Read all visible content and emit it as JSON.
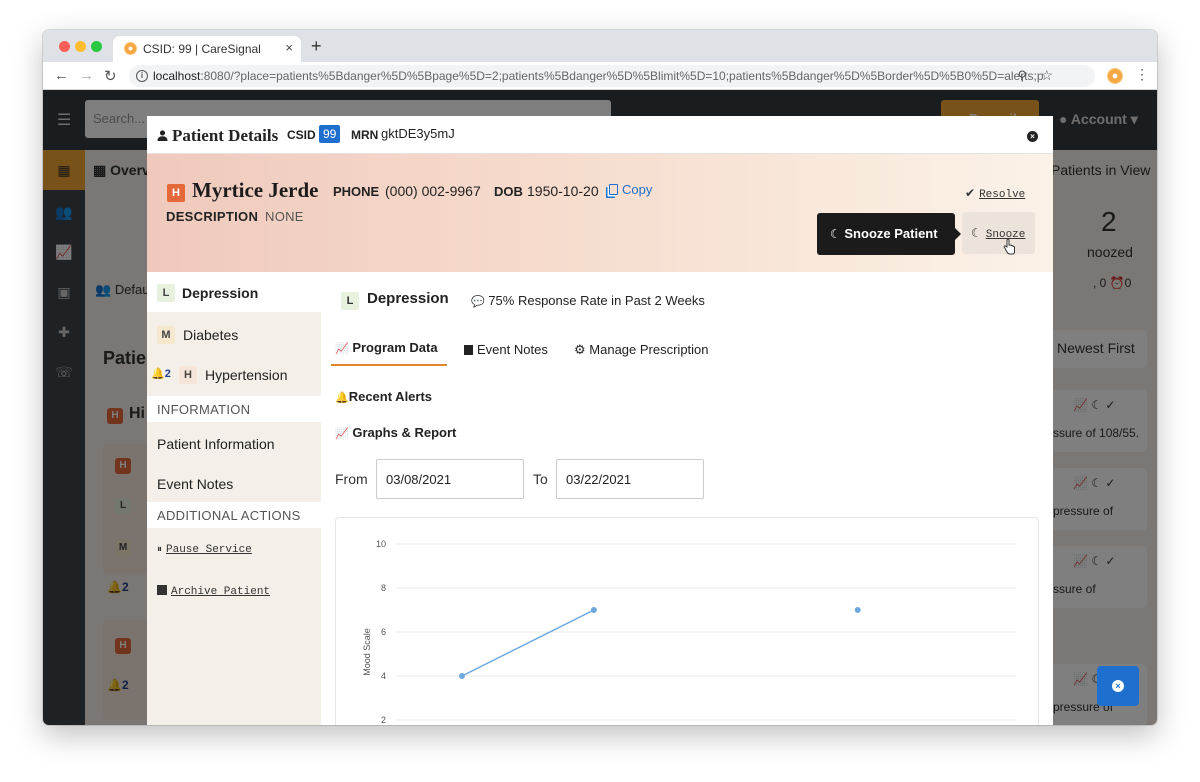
{
  "browser": {
    "tab_title": "CSID: 99 | CareSignal",
    "new_tab": "+",
    "tab_close": "×",
    "url_host": "localhost",
    "url_rest": ":8080/?place=patients%5Bdanger%5D%5Bpage%5D=2;patients%5Bdanger%5D%5Blimit%5D=10;patients%5Bdanger%5D%5Border%5D%5B0%5D=alerts;patien...",
    "back": "←",
    "forward": "→",
    "reload": "↻",
    "zoom_icon": "⚲",
    "star_icon": "☆",
    "menu_icon": "⋮"
  },
  "app_background": {
    "search_placeholder": "Search...",
    "prescription_button": "Prescribe",
    "account": "Account",
    "overview_label": "Overv",
    "patients_in_view": "Patients in View",
    "snoozed_count": "2",
    "snoozed_label": "noozed",
    "snoozed_meta": ", 0   ⏰0",
    "default_label": "Defau",
    "patients_heading": "Patie",
    "high_label": "Hi",
    "sort_label": "Newest First",
    "alert_snippets": [
      "ssure of 108/55.",
      "pressure of",
      "ssure of",
      "pressure of"
    ]
  },
  "modal": {
    "title": "Patient Details",
    "csid_label": "CSID",
    "csid_value": "99",
    "mrn_label": "MRN",
    "mrn_value": "gktDE3y5mJ",
    "close_icon": "×"
  },
  "patient": {
    "risk_chip": "H",
    "name": "Myrtice Jerde",
    "phone_label": "PHONE",
    "phone_value": "(000) 002-9967",
    "dob_label": "DOB",
    "dob_value": "1950-10-20",
    "copy_label": "Copy",
    "description_label": "DESCRIPTION",
    "description_value": "NONE",
    "resolve_label": "Resolve",
    "snooze_tooltip": "Snooze Patient",
    "snooze_label": "Snooze"
  },
  "sidebar": {
    "programs": [
      {
        "chip": "L",
        "label": "Depression",
        "active": true
      },
      {
        "chip": "M",
        "label": "Diabetes",
        "active": false
      },
      {
        "chip": "H",
        "label": "Hypertension",
        "active": false,
        "alert_count": "2"
      }
    ],
    "information_heading": "INFORMATION",
    "info_links": [
      "Patient Information",
      "Event Notes"
    ],
    "actions_heading": "ADDITIONAL ACTIONS",
    "actions": [
      "Pause Service",
      "Archive Patient"
    ]
  },
  "program": {
    "chip": "L",
    "title": "Depression",
    "response_rate": "75% Response Rate in Past 2 Weeks",
    "tabs": [
      "Program Data",
      "Event Notes",
      "Manage Prescription"
    ],
    "active_tab": "Program Data",
    "recent_alerts": "Recent Alerts",
    "graphs_report": "Graphs & Report",
    "from_label": "From",
    "from_value": "03/08/2021",
    "to_label": "To",
    "to_value": "03/22/2021"
  },
  "chart_data": {
    "type": "line",
    "ylabel": "Mood Scale",
    "yticks": [
      10,
      8,
      6,
      4,
      2
    ],
    "ylim": [
      2,
      10
    ],
    "series_color": "#6fa8e0",
    "segments": [
      [
        {
          "x": 0,
          "y": 4
        },
        {
          "x": 1,
          "y": 7
        }
      ]
    ],
    "points": [
      {
        "x": 0,
        "y": 4
      },
      {
        "x": 1,
        "y": 7
      },
      {
        "x": 3,
        "y": 7
      }
    ],
    "xlim": [
      -0.5,
      4.2
    ],
    "grid": true
  },
  "colors": {
    "accent_orange": "#f0a431",
    "high_risk": "#e4683a",
    "primary_blue": "#1f6fcf"
  }
}
